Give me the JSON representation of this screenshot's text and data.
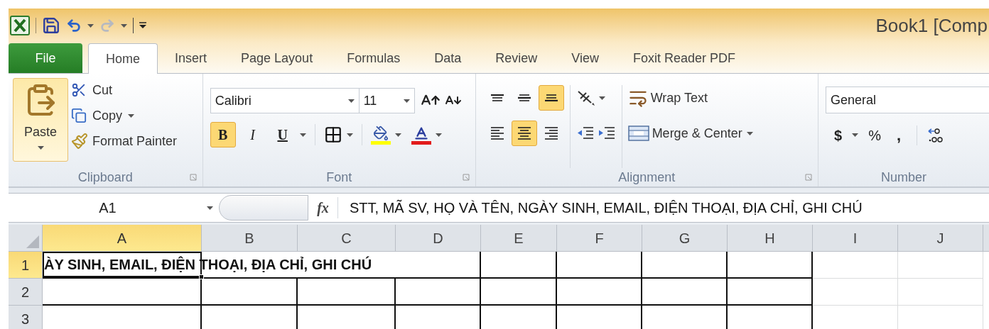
{
  "window": {
    "title": "Book1  [Comp"
  },
  "tabs": [
    {
      "label": "File",
      "kind": "file",
      "selected": false
    },
    {
      "label": "Home",
      "kind": "tab",
      "selected": true
    },
    {
      "label": "Insert",
      "kind": "tab",
      "selected": false
    },
    {
      "label": "Page Layout",
      "kind": "tab",
      "selected": false
    },
    {
      "label": "Formulas",
      "kind": "tab",
      "selected": false
    },
    {
      "label": "Data",
      "kind": "tab",
      "selected": false
    },
    {
      "label": "Review",
      "kind": "tab",
      "selected": false
    },
    {
      "label": "View",
      "kind": "tab",
      "selected": false
    },
    {
      "label": "Foxit Reader PDF",
      "kind": "tab",
      "selected": false
    }
  ],
  "clipboard": {
    "label": "Clipboard",
    "paste": "Paste",
    "cut": "Cut",
    "copy": "Copy",
    "format_painter": "Format Painter"
  },
  "font": {
    "label": "Font",
    "name": "Calibri",
    "size": "11",
    "styles": [
      {
        "kind": "bold",
        "label": "B",
        "selected": true
      },
      {
        "kind": "italic",
        "label": "I",
        "selected": false
      },
      {
        "kind": "underline",
        "label": "U",
        "selected": false
      }
    ]
  },
  "alignment": {
    "label": "Alignment",
    "vertical": [
      {
        "kind": "top",
        "selected": false
      },
      {
        "kind": "middle",
        "selected": false
      },
      {
        "kind": "bottom",
        "selected": true
      }
    ],
    "horizontal": [
      {
        "kind": "left",
        "selected": false
      },
      {
        "kind": "center",
        "selected": true
      },
      {
        "kind": "right",
        "selected": false
      }
    ],
    "wrap_text": "Wrap Text",
    "merge": "Merge & Center"
  },
  "number": {
    "label": "Number",
    "format": "General",
    "currency": "$",
    "percent": "%",
    "comma": ","
  },
  "formula_bar": {
    "name_box": "A1",
    "fx": "fx",
    "content": "STT, MÃ SV, HỌ VÀ TÊN, NGÀY SINH, EMAIL, ĐIỆN THOẠI, ĐỊA CHỈ, GHI CHÚ"
  },
  "sheet": {
    "columns": [
      {
        "label": "A",
        "selected": true,
        "bordered": true
      },
      {
        "label": "B",
        "selected": false,
        "bordered": true
      },
      {
        "label": "C",
        "selected": false,
        "bordered": true
      },
      {
        "label": "D",
        "selected": false,
        "bordered": true
      },
      {
        "label": "E",
        "selected": false,
        "bordered": true
      },
      {
        "label": "F",
        "selected": false,
        "bordered": true
      },
      {
        "label": "G",
        "selected": false,
        "bordered": true
      },
      {
        "label": "H",
        "selected": false,
        "bordered": true
      },
      {
        "label": "I",
        "selected": false,
        "bordered": false
      },
      {
        "label": "J",
        "selected": false,
        "bordered": false
      }
    ],
    "rows": [
      {
        "label": "1",
        "selected": true,
        "text": "ÀY SINH, EMAIL, ĐIỆN THOẠI, ĐỊA CHỈ, GHI CHÚ"
      },
      {
        "label": "2",
        "selected": false
      },
      {
        "label": "3",
        "selected": false
      }
    ]
  }
}
